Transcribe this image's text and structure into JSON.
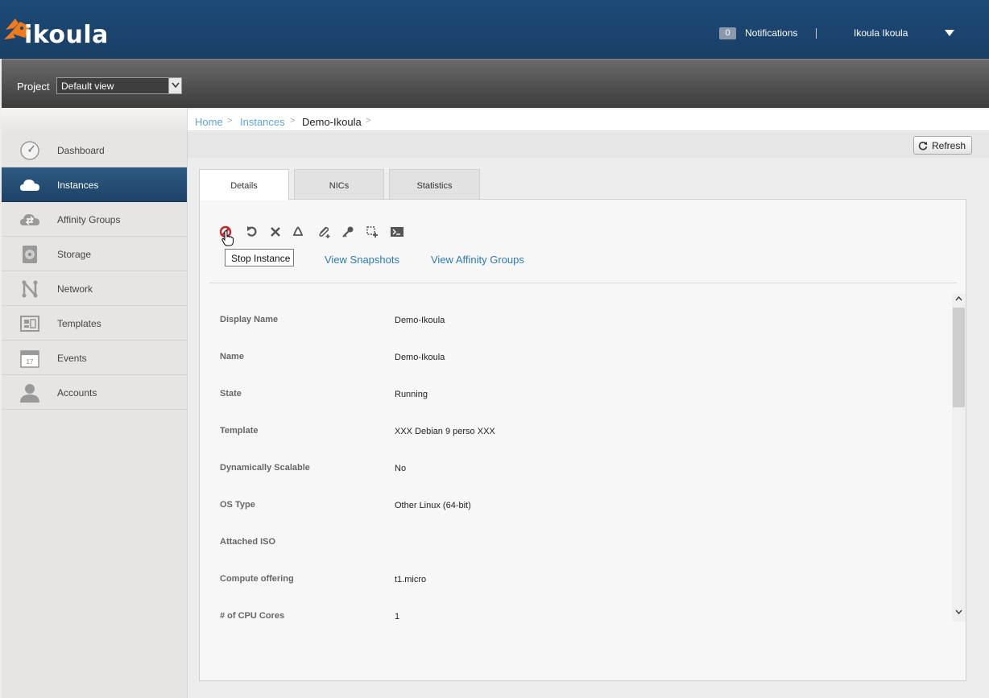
{
  "header": {
    "logo_text": "ikoula",
    "notifications_count": "0",
    "notifications_label": "Notifications",
    "user_name": "Ikoula Ikoula"
  },
  "project": {
    "label": "Project",
    "selected": "Default view"
  },
  "sidebar": {
    "items": [
      {
        "label": "Dashboard",
        "icon": "dashboard-icon",
        "active": false
      },
      {
        "label": "Instances",
        "icon": "cloud-icon",
        "active": true
      },
      {
        "label": "Affinity Groups",
        "icon": "affinity-icon",
        "active": false
      },
      {
        "label": "Storage",
        "icon": "storage-icon",
        "active": false
      },
      {
        "label": "Network",
        "icon": "network-icon",
        "active": false
      },
      {
        "label": "Templates",
        "icon": "templates-icon",
        "active": false
      },
      {
        "label": "Events",
        "icon": "calendar-icon",
        "active": false
      },
      {
        "label": "Accounts",
        "icon": "user-icon",
        "active": false
      }
    ]
  },
  "breadcrumb": {
    "home": "Home",
    "instances": "Instances",
    "current": "Demo-Ikoula",
    "sep": ">"
  },
  "toolbar": {
    "refresh_label": "Refresh"
  },
  "tabs": {
    "details": "Details",
    "nics": "NICs",
    "statistics": "Statistics"
  },
  "actions": {
    "tooltip": "Stop Instance",
    "view_snapshots": "View Snapshots",
    "view_affinity_groups": "View Affinity Groups",
    "icons": [
      "stop-icon",
      "reboot-icon",
      "destroy-icon",
      "recycle-icon",
      "attach-iso-icon",
      "key-icon",
      "scale-icon",
      "console-icon"
    ]
  },
  "details": [
    {
      "label": "Display Name",
      "value": "Demo-Ikoula"
    },
    {
      "label": "Name",
      "value": "Demo-Ikoula"
    },
    {
      "label": "State",
      "value": "Running"
    },
    {
      "label": "Template",
      "value": "XXX Debian 9 perso XXX"
    },
    {
      "label": "Dynamically Scalable",
      "value": "No"
    },
    {
      "label": "OS Type",
      "value": "Other Linux (64-bit)"
    },
    {
      "label": "Attached ISO",
      "value": ""
    },
    {
      "label": "Compute offering",
      "value": "t1.micro"
    },
    {
      "label": "# of CPU Cores",
      "value": "1"
    }
  ],
  "colors": {
    "header_bg": "#1c4a78",
    "active_nav": "#2e5a82",
    "link": "#2d7bb6",
    "logo_orange": "#f07b1c"
  }
}
